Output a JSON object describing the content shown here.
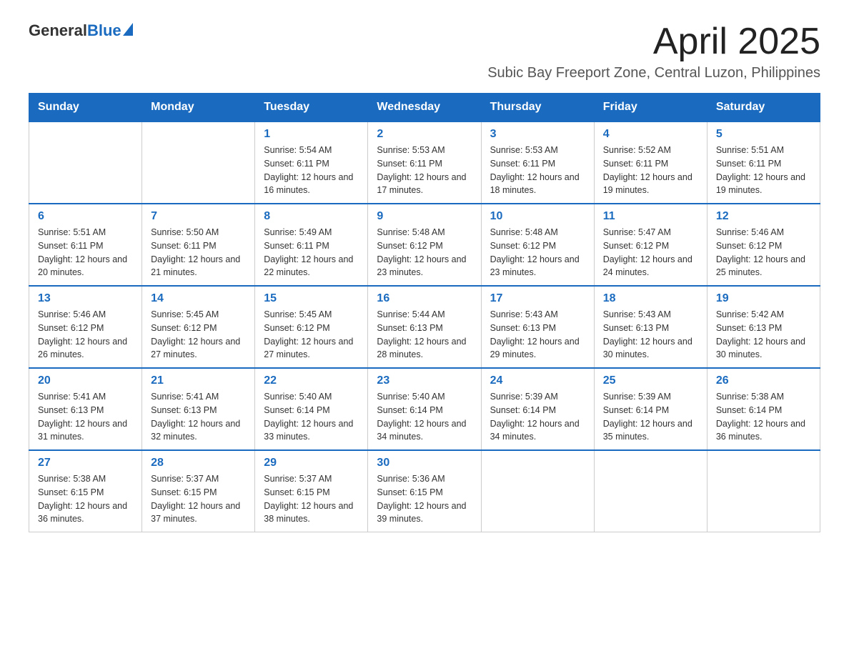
{
  "header": {
    "logo_general": "General",
    "logo_blue": "Blue",
    "month_year": "April 2025",
    "subtitle": "Subic Bay Freeport Zone, Central Luzon, Philippines"
  },
  "weekdays": [
    "Sunday",
    "Monday",
    "Tuesday",
    "Wednesday",
    "Thursday",
    "Friday",
    "Saturday"
  ],
  "weeks": [
    [
      {
        "day": "",
        "sunrise": "",
        "sunset": "",
        "daylight": ""
      },
      {
        "day": "",
        "sunrise": "",
        "sunset": "",
        "daylight": ""
      },
      {
        "day": "1",
        "sunrise": "Sunrise: 5:54 AM",
        "sunset": "Sunset: 6:11 PM",
        "daylight": "Daylight: 12 hours and 16 minutes."
      },
      {
        "day": "2",
        "sunrise": "Sunrise: 5:53 AM",
        "sunset": "Sunset: 6:11 PM",
        "daylight": "Daylight: 12 hours and 17 minutes."
      },
      {
        "day": "3",
        "sunrise": "Sunrise: 5:53 AM",
        "sunset": "Sunset: 6:11 PM",
        "daylight": "Daylight: 12 hours and 18 minutes."
      },
      {
        "day": "4",
        "sunrise": "Sunrise: 5:52 AM",
        "sunset": "Sunset: 6:11 PM",
        "daylight": "Daylight: 12 hours and 19 minutes."
      },
      {
        "day": "5",
        "sunrise": "Sunrise: 5:51 AM",
        "sunset": "Sunset: 6:11 PM",
        "daylight": "Daylight: 12 hours and 19 minutes."
      }
    ],
    [
      {
        "day": "6",
        "sunrise": "Sunrise: 5:51 AM",
        "sunset": "Sunset: 6:11 PM",
        "daylight": "Daylight: 12 hours and 20 minutes."
      },
      {
        "day": "7",
        "sunrise": "Sunrise: 5:50 AM",
        "sunset": "Sunset: 6:11 PM",
        "daylight": "Daylight: 12 hours and 21 minutes."
      },
      {
        "day": "8",
        "sunrise": "Sunrise: 5:49 AM",
        "sunset": "Sunset: 6:11 PM",
        "daylight": "Daylight: 12 hours and 22 minutes."
      },
      {
        "day": "9",
        "sunrise": "Sunrise: 5:48 AM",
        "sunset": "Sunset: 6:12 PM",
        "daylight": "Daylight: 12 hours and 23 minutes."
      },
      {
        "day": "10",
        "sunrise": "Sunrise: 5:48 AM",
        "sunset": "Sunset: 6:12 PM",
        "daylight": "Daylight: 12 hours and 23 minutes."
      },
      {
        "day": "11",
        "sunrise": "Sunrise: 5:47 AM",
        "sunset": "Sunset: 6:12 PM",
        "daylight": "Daylight: 12 hours and 24 minutes."
      },
      {
        "day": "12",
        "sunrise": "Sunrise: 5:46 AM",
        "sunset": "Sunset: 6:12 PM",
        "daylight": "Daylight: 12 hours and 25 minutes."
      }
    ],
    [
      {
        "day": "13",
        "sunrise": "Sunrise: 5:46 AM",
        "sunset": "Sunset: 6:12 PM",
        "daylight": "Daylight: 12 hours and 26 minutes."
      },
      {
        "day": "14",
        "sunrise": "Sunrise: 5:45 AM",
        "sunset": "Sunset: 6:12 PM",
        "daylight": "Daylight: 12 hours and 27 minutes."
      },
      {
        "day": "15",
        "sunrise": "Sunrise: 5:45 AM",
        "sunset": "Sunset: 6:12 PM",
        "daylight": "Daylight: 12 hours and 27 minutes."
      },
      {
        "day": "16",
        "sunrise": "Sunrise: 5:44 AM",
        "sunset": "Sunset: 6:13 PM",
        "daylight": "Daylight: 12 hours and 28 minutes."
      },
      {
        "day": "17",
        "sunrise": "Sunrise: 5:43 AM",
        "sunset": "Sunset: 6:13 PM",
        "daylight": "Daylight: 12 hours and 29 minutes."
      },
      {
        "day": "18",
        "sunrise": "Sunrise: 5:43 AM",
        "sunset": "Sunset: 6:13 PM",
        "daylight": "Daylight: 12 hours and 30 minutes."
      },
      {
        "day": "19",
        "sunrise": "Sunrise: 5:42 AM",
        "sunset": "Sunset: 6:13 PM",
        "daylight": "Daylight: 12 hours and 30 minutes."
      }
    ],
    [
      {
        "day": "20",
        "sunrise": "Sunrise: 5:41 AM",
        "sunset": "Sunset: 6:13 PM",
        "daylight": "Daylight: 12 hours and 31 minutes."
      },
      {
        "day": "21",
        "sunrise": "Sunrise: 5:41 AM",
        "sunset": "Sunset: 6:13 PM",
        "daylight": "Daylight: 12 hours and 32 minutes."
      },
      {
        "day": "22",
        "sunrise": "Sunrise: 5:40 AM",
        "sunset": "Sunset: 6:14 PM",
        "daylight": "Daylight: 12 hours and 33 minutes."
      },
      {
        "day": "23",
        "sunrise": "Sunrise: 5:40 AM",
        "sunset": "Sunset: 6:14 PM",
        "daylight": "Daylight: 12 hours and 34 minutes."
      },
      {
        "day": "24",
        "sunrise": "Sunrise: 5:39 AM",
        "sunset": "Sunset: 6:14 PM",
        "daylight": "Daylight: 12 hours and 34 minutes."
      },
      {
        "day": "25",
        "sunrise": "Sunrise: 5:39 AM",
        "sunset": "Sunset: 6:14 PM",
        "daylight": "Daylight: 12 hours and 35 minutes."
      },
      {
        "day": "26",
        "sunrise": "Sunrise: 5:38 AM",
        "sunset": "Sunset: 6:14 PM",
        "daylight": "Daylight: 12 hours and 36 minutes."
      }
    ],
    [
      {
        "day": "27",
        "sunrise": "Sunrise: 5:38 AM",
        "sunset": "Sunset: 6:15 PM",
        "daylight": "Daylight: 12 hours and 36 minutes."
      },
      {
        "day": "28",
        "sunrise": "Sunrise: 5:37 AM",
        "sunset": "Sunset: 6:15 PM",
        "daylight": "Daylight: 12 hours and 37 minutes."
      },
      {
        "day": "29",
        "sunrise": "Sunrise: 5:37 AM",
        "sunset": "Sunset: 6:15 PM",
        "daylight": "Daylight: 12 hours and 38 minutes."
      },
      {
        "day": "30",
        "sunrise": "Sunrise: 5:36 AM",
        "sunset": "Sunset: 6:15 PM",
        "daylight": "Daylight: 12 hours and 39 minutes."
      },
      {
        "day": "",
        "sunrise": "",
        "sunset": "",
        "daylight": ""
      },
      {
        "day": "",
        "sunrise": "",
        "sunset": "",
        "daylight": ""
      },
      {
        "day": "",
        "sunrise": "",
        "sunset": "",
        "daylight": ""
      }
    ]
  ]
}
